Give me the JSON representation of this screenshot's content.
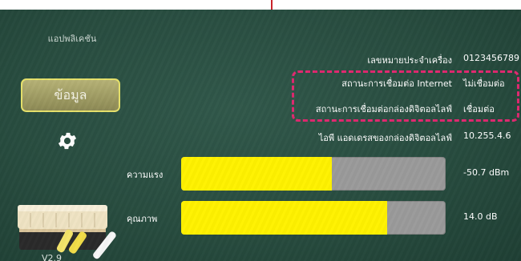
{
  "sidebar": {
    "app_label": "แอปพลิเคชัน",
    "info_button": "ข้อมูล",
    "version": "V2.9",
    "accent_color": "#e6e16b"
  },
  "info": {
    "rows": [
      {
        "label": "เลขหมายประจำเครื่อง",
        "value": "0123456789"
      },
      {
        "label": "สถานะการเชื่อมต่อ Internet",
        "value": "ไม่เชื่อมต่อ"
      },
      {
        "label": "สถานะการเชื่อมต่อกล่องดิจิตอลไลฟ์",
        "value": "เชื่อมต่อ"
      },
      {
        "label": "ไอพี แอดเดรสของกล่องดิจิตอลไลฟ์",
        "value": "10.255.4.6"
      }
    ],
    "highlight_color": "#e0286f"
  },
  "signal": {
    "strength_label": "ความแรง",
    "strength_value": "-50.7 dBm",
    "strength_fraction": 0.57,
    "quality_label": "คุณภาพ",
    "quality_value": "14.0 dB",
    "quality_fraction": 0.78,
    "fill_color": "#fff200"
  }
}
